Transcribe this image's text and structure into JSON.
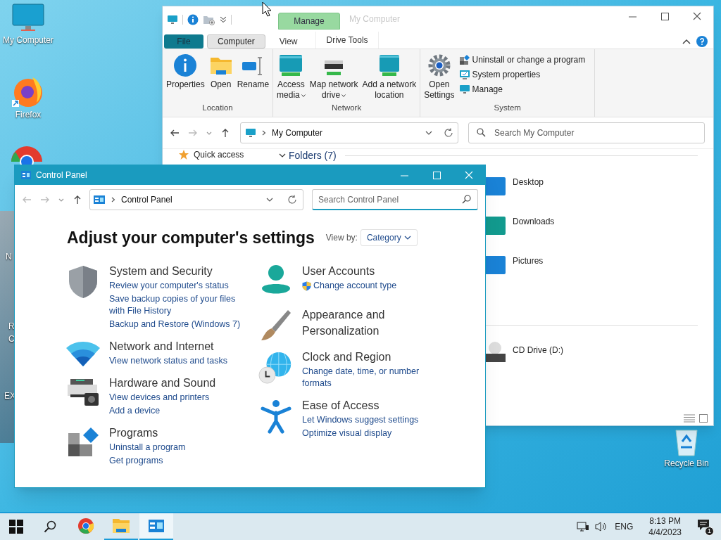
{
  "desktop": {
    "icons": [
      {
        "label": "My Computer"
      },
      {
        "label": "Firefox"
      },
      {
        "label": "Recycle Bin"
      }
    ],
    "fragments": [
      "N",
      "R",
      "C",
      "EX"
    ]
  },
  "explorer": {
    "title": "My Computer",
    "context_tab": "Manage",
    "tabs": [
      {
        "label": "File",
        "kind": "file",
        "selected": false
      },
      {
        "label": "Computer",
        "kind": "tab",
        "selected": true
      },
      {
        "label": "View",
        "kind": "tab",
        "selected": false
      },
      {
        "label": "Drive Tools",
        "kind": "context",
        "selected": false
      }
    ],
    "groups": [
      {
        "label": "Location",
        "buttons": [
          {
            "label": "Properties",
            "dropdown": false
          },
          {
            "label": "Open",
            "dropdown": false
          },
          {
            "label": "Rename",
            "dropdown": false
          }
        ]
      },
      {
        "label": "Network",
        "buttons": [
          {
            "label": "Access\nmedia",
            "dropdown": true
          },
          {
            "label": "Map network\ndrive",
            "dropdown": true
          },
          {
            "label": "Add a network\nlocation",
            "dropdown": false
          }
        ]
      },
      {
        "label": "System",
        "buttons": [
          {
            "label": "Open\nSettings",
            "dropdown": false
          }
        ],
        "small_buttons": [
          {
            "label": "Uninstall or change a program"
          },
          {
            "label": "System properties"
          },
          {
            "label": "Manage"
          }
        ]
      }
    ],
    "address": "My Computer",
    "search_placeholder": "Search My Computer",
    "nav": [
      {
        "label": "Quick access"
      }
    ],
    "section_header": "Folders (7)",
    "folders": [
      {
        "name": "Desktop"
      },
      {
        "name": "Downloads"
      },
      {
        "name": "Pictures"
      }
    ],
    "drives": [
      {
        "name": "CD Drive (D:)"
      }
    ]
  },
  "control_panel": {
    "title": "Control Panel",
    "address": "Control Panel",
    "search_placeholder": "Search Control Panel",
    "heading": "Adjust your computer's settings",
    "view_by_label": "View by:",
    "view_by_value": "Category",
    "left_categories": [
      {
        "title": "System and Security",
        "links": [
          {
            "label": "Review your computer's status",
            "admin": false
          },
          {
            "label": "Save backup copies of your files with File History",
            "admin": false
          },
          {
            "label": "Backup and Restore (Windows 7)",
            "admin": false
          }
        ]
      },
      {
        "title": "Network and Internet",
        "links": [
          {
            "label": "View network status and tasks",
            "admin": false
          }
        ]
      },
      {
        "title": "Hardware and Sound",
        "links": [
          {
            "label": "View devices and printers",
            "admin": false
          },
          {
            "label": "Add a device",
            "admin": false
          }
        ]
      },
      {
        "title": "Programs",
        "links": [
          {
            "label": "Uninstall a program",
            "admin": false
          },
          {
            "label": "Get programs",
            "admin": false
          }
        ]
      }
    ],
    "right_categories": [
      {
        "title": "User Accounts",
        "links": [
          {
            "label": "Change account type",
            "admin": true
          }
        ]
      },
      {
        "title": "Appearance and Personalization"
      },
      {
        "title": "Clock and Region",
        "links": [
          {
            "label": "Change date, time, or number formats",
            "admin": false
          }
        ]
      },
      {
        "title": "Ease of Access",
        "links": [
          {
            "label": "Let Windows suggest settings",
            "admin": false
          },
          {
            "label": "Optimize visual display",
            "admin": false
          }
        ]
      }
    ]
  },
  "taskbar": {
    "apps": [
      {
        "running": false,
        "selected": false
      },
      {
        "running": true,
        "selected": false
      },
      {
        "running": true,
        "selected": true
      }
    ],
    "language": "ENG",
    "time": "8:13 PM",
    "date": "4/4/2023",
    "notification_count": "1"
  }
}
